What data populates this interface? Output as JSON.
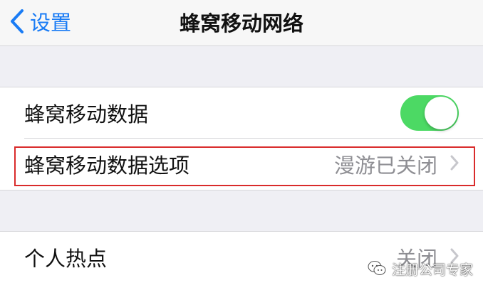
{
  "navbar": {
    "back_label": "设置",
    "title": "蜂窝移动网络"
  },
  "section1": {
    "cellular_data": {
      "label": "蜂窝移动数据",
      "toggle_on": true
    },
    "cellular_options": {
      "label": "蜂窝移动数据选项",
      "value": "漫游已关闭"
    }
  },
  "section2": {
    "hotspot": {
      "label": "个人热点",
      "value": "关闭"
    }
  },
  "watermark": {
    "text": "注册公司专家"
  },
  "colors": {
    "accent": "#1a7cf5",
    "toggle_on": "#4cd964",
    "highlight": "#d92b2b",
    "background": "#efeff4"
  },
  "icons": {
    "back": "chevron-left-icon",
    "disclosure": "chevron-right-icon",
    "watermark": "wechat-icon"
  }
}
